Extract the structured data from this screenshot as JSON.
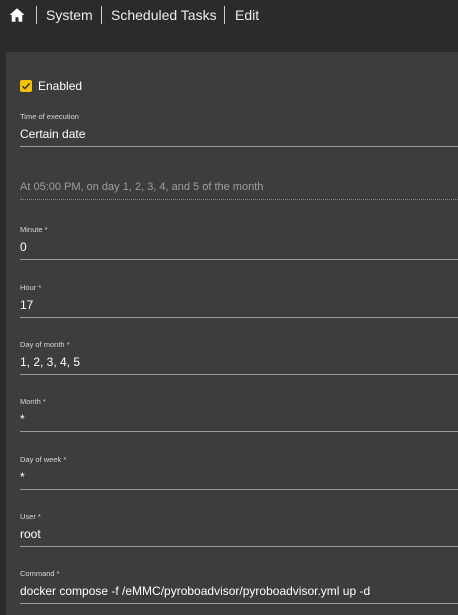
{
  "breadcrumb": {
    "items": [
      "System",
      "Scheduled Tasks",
      "Edit"
    ]
  },
  "form": {
    "enabled_label": "Enabled",
    "enabled_checked": true,
    "time_of_execution": {
      "label": "Time of execution",
      "value": "Certain date"
    },
    "schedule_summary": "At 05:00 PM, on day 1, 2, 3, 4, and 5 of the month",
    "minute": {
      "label": "Minute *",
      "value": "0"
    },
    "hour": {
      "label": "Hour *",
      "value": "17"
    },
    "day_of_month": {
      "label": "Day of month *",
      "value": "1, 2, 3, 4, 5"
    },
    "month": {
      "label": "Month *",
      "value": "*"
    },
    "day_of_week": {
      "label": "Day of week *",
      "value": "*"
    },
    "user": {
      "label": "User *",
      "value": "root"
    },
    "command": {
      "label": "Command *",
      "value": "docker compose -f /eMMC/pyroboadvisor/pyroboadvisor.yml up -d"
    }
  },
  "colors": {
    "accent": "#f5c400",
    "background": "#2b2b2b",
    "card": "#3d3d3d"
  }
}
